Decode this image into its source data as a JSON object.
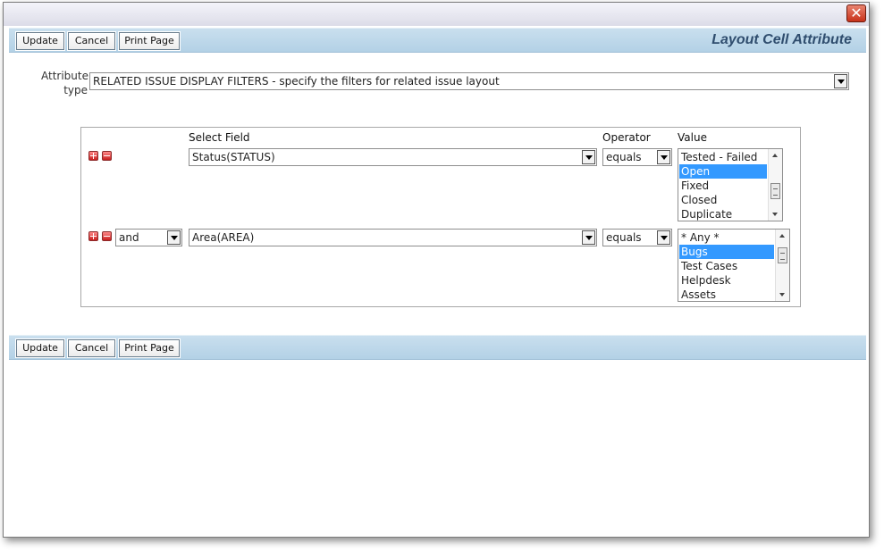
{
  "window": {
    "close_label": "✕"
  },
  "toolbar": {
    "update_label": "Update",
    "cancel_label": "Cancel",
    "print_label": "Print Page",
    "title": "Layout Cell Attribute"
  },
  "attribute_type": {
    "label": "Attribute type",
    "value": "RELATED ISSUE DISPLAY FILTERS - specify the filters for related issue layout"
  },
  "filters": {
    "headers": {
      "field": "Select Field",
      "operator": "Operator",
      "value": "Value"
    },
    "rows": [
      {
        "connector": "",
        "field": "Status(STATUS)",
        "operator": "equals",
        "values": [
          "Tested - Failed",
          "Open",
          "Fixed",
          "Closed",
          "Duplicate"
        ],
        "selected": "Open"
      },
      {
        "connector": "and",
        "field": "Area(AREA)",
        "operator": "equals",
        "values": [
          "* Any *",
          "Bugs",
          "Test Cases",
          "Helpdesk",
          "Assets"
        ],
        "selected": "Bugs"
      }
    ]
  },
  "colors": {
    "toolbar": "#b9d5e9",
    "selection": "#3399ff",
    "title_text": "#2f4d6e"
  }
}
